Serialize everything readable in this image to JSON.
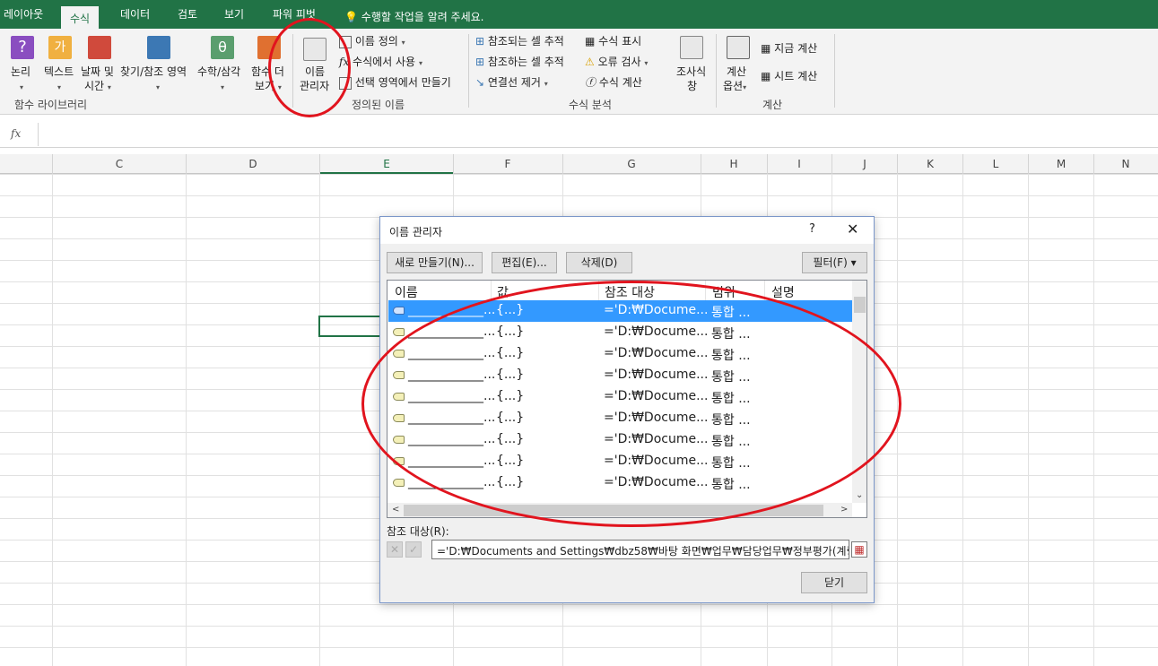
{
  "tabs": [
    {
      "label": "레이아웃"
    },
    {
      "label": "수식",
      "active": true
    },
    {
      "label": "데이터"
    },
    {
      "label": "검토"
    },
    {
      "label": "보기"
    },
    {
      "label": "파워 피벗"
    }
  ],
  "tell_me": "수행할 작업을 알려 주세요.",
  "ribbon": {
    "func_lib": {
      "logic": "논리",
      "text": "텍스트",
      "date_time_1": "날짜 및",
      "date_time_2": "시간",
      "lookup": "찾기/참조 영역",
      "math": "수학/삼각",
      "more_1": "함수 더",
      "more_2": "보기",
      "group": "함수 라이브러리"
    },
    "defined_names": {
      "name_manager_1": "이름",
      "name_manager_2": "관리자",
      "define_name": "이름 정의",
      "use_in_formula": "수식에서 사용",
      "create_from_selection": "선택 영역에서 만들기",
      "group": "정의된 이름"
    },
    "auditing": {
      "trace_precedents": "참조되는 셀 추적",
      "trace_dependents": "참조하는 셀 추적",
      "remove_arrows": "연결선 제거",
      "show_formulas": "수식 표시",
      "error_checking": "오류 검사",
      "evaluate_formula": "수식 계산",
      "watch_1": "조사식",
      "watch_2": "창",
      "group": "수식 분석"
    },
    "calculation": {
      "options_1": "계산",
      "options_2": "옵션",
      "calc_now": "지금 계산",
      "calc_sheet": "시트 계산",
      "group": "계산"
    }
  },
  "formula_bar": {
    "fx": "fx",
    "value": ""
  },
  "columns": [
    "C",
    "D",
    "E",
    "F",
    "G",
    "H",
    "I",
    "J",
    "K",
    "L",
    "M",
    "N"
  ],
  "dialog": {
    "title": "이름 관리자",
    "help": "?",
    "close": "✕",
    "btn_new": "새로 만들기(N)...",
    "btn_edit": "편집(E)...",
    "btn_delete": "삭제(D)",
    "btn_filter": "필터(F) ▾",
    "headers": {
      "name": "이름",
      "value": "값",
      "refers_to": "참조 대상",
      "scope": "범위",
      "comment": "설명"
    },
    "rows": [
      {
        "name": "____________...",
        "value": "{...}",
        "refers_to": "='D:₩Docume...",
        "scope": "통합 ...",
        "selected": true
      },
      {
        "name": "____________...",
        "value": "{...}",
        "refers_to": "='D:₩Docume...",
        "scope": "통합 ..."
      },
      {
        "name": "____________...",
        "value": "{...}",
        "refers_to": "='D:₩Docume...",
        "scope": "통합 ..."
      },
      {
        "name": "____________...",
        "value": "{...}",
        "refers_to": "='D:₩Docume...",
        "scope": "통합 ..."
      },
      {
        "name": "____________...",
        "value": "{...}",
        "refers_to": "='D:₩Docume...",
        "scope": "통합 ..."
      },
      {
        "name": "____________...",
        "value": "{...}",
        "refers_to": "='D:₩Docume...",
        "scope": "통합 ..."
      },
      {
        "name": "____________...",
        "value": "{...}",
        "refers_to": "='D:₩Docume...",
        "scope": "통합 ..."
      },
      {
        "name": "____________...",
        "value": "{...}",
        "refers_to": "='D:₩Docume...",
        "scope": "통합 ..."
      },
      {
        "name": "____________...",
        "value": "{...}",
        "refers_to": "='D:₩Docume...",
        "scope": "통합 ..."
      }
    ],
    "refers_label": "참조 대상(R):",
    "refers_value": "='D:₩Documents and Settings₩dbz58₩바탕 화면₩업무₩담당업무₩정부평가(계량)₩",
    "btn_close": "닫기"
  }
}
